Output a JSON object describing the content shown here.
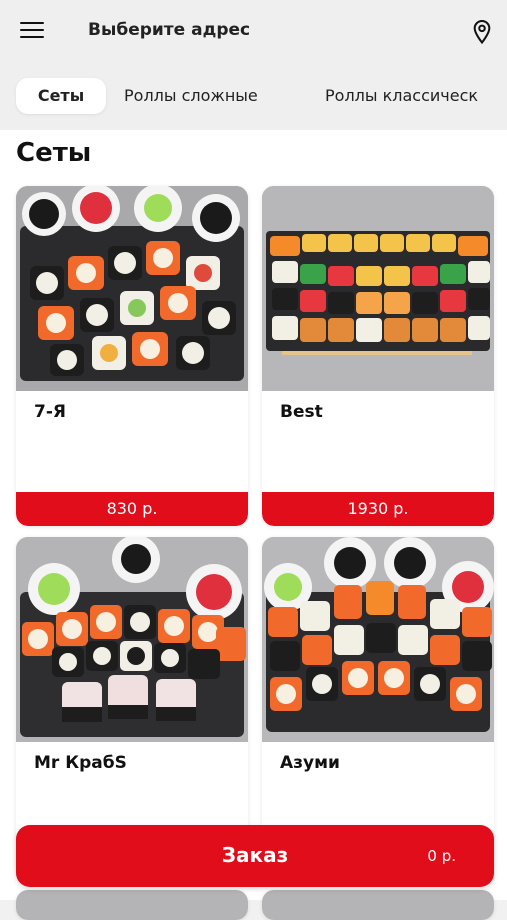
{
  "header": {
    "address_label": "Выберите адрес",
    "menu_icon": "hamburger-menu-icon",
    "location_icon": "location-pin-icon"
  },
  "tabs": [
    {
      "label": "Сеты",
      "active": true
    },
    {
      "label": "Роллы сложные",
      "active": false
    },
    {
      "label": "Роллы классическ",
      "active": false
    }
  ],
  "section": {
    "title": "Сеты"
  },
  "products": [
    {
      "name": "7-Я",
      "price": "830 р."
    },
    {
      "name": "Best",
      "price": "1930 р."
    },
    {
      "name": "Mr КрабS",
      "price": ""
    },
    {
      "name": "Азуми",
      "price": ""
    }
  ],
  "order": {
    "label": "Заказ",
    "total": "0 р."
  },
  "colors": {
    "accent": "#e20d1a",
    "header_bg": "#efefef"
  }
}
